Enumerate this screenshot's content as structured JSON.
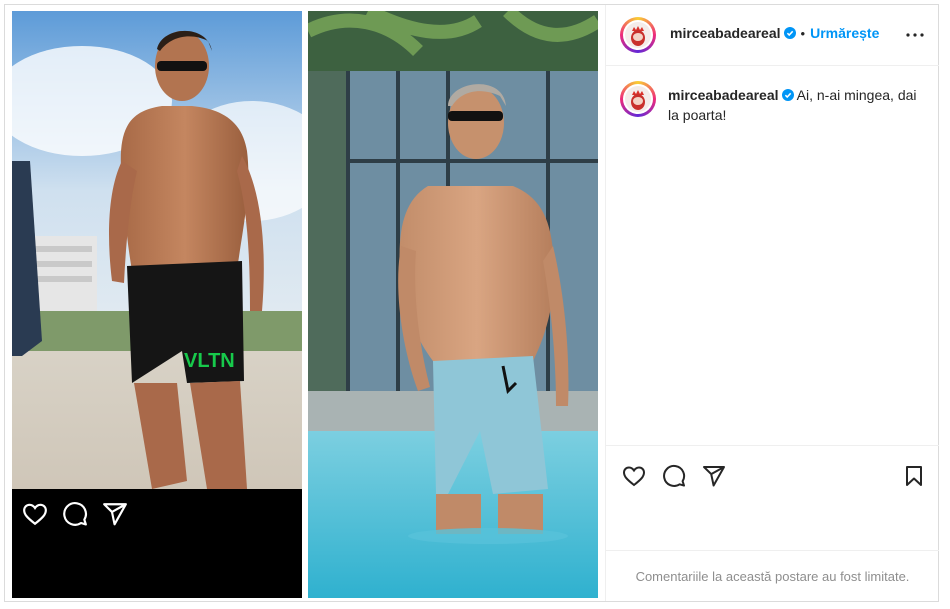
{
  "post": {
    "username": "mirceabadeareal",
    "follow_label": "Urmărește",
    "separator": "•",
    "caption_text": "Ai, n-ai mingea, dai la poarta!",
    "comments_limited_text": "Comentariile la această postare au fost limitate."
  },
  "colors": {
    "accent": "#0095f6",
    "verified": "#0095f6",
    "muted": "#8e8e8e",
    "text": "#262626"
  },
  "icons": {
    "like": "heart-icon",
    "comment": "comment-icon",
    "share": "share-icon",
    "save": "bookmark-icon",
    "more": "more-icon",
    "verified": "verified-badge-icon"
  }
}
